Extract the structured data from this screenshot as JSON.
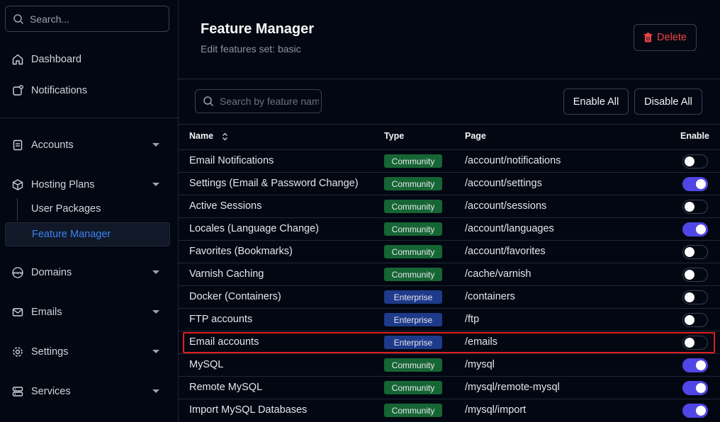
{
  "sidebar": {
    "search_placeholder": "Search...",
    "top_items": [
      {
        "label": "Dashboard",
        "icon": "home-icon"
      },
      {
        "label": "Notifications",
        "icon": "notification-icon"
      }
    ],
    "groups": [
      {
        "label": "Accounts",
        "icon": "accounts-icon"
      },
      {
        "label": "Hosting Plans",
        "icon": "package-icon",
        "children": [
          "User Packages",
          "Feature Manager"
        ]
      },
      {
        "label": "Domains",
        "icon": "www-icon"
      },
      {
        "label": "Emails",
        "icon": "mail-icon"
      },
      {
        "label": "Settings",
        "icon": "gear-icon"
      },
      {
        "label": "Services",
        "icon": "server-icon"
      }
    ]
  },
  "header": {
    "title": "Feature Manager",
    "subtitle": "Edit features set: basic",
    "delete_label": "Delete"
  },
  "toolbar": {
    "search_placeholder": "Search by feature name",
    "enable_all_label": "Enable All",
    "disable_all_label": "Disable All"
  },
  "table": {
    "columns": {
      "name": "Name",
      "type": "Type",
      "page": "Page",
      "enable": "Enable"
    },
    "rows": [
      {
        "name": "Email Notifications",
        "type": "Community",
        "page": "/account/notifications",
        "enabled": false
      },
      {
        "name": "Settings (Email & Password Change)",
        "type": "Community",
        "page": "/account/settings",
        "enabled": true
      },
      {
        "name": "Active Sessions",
        "type": "Community",
        "page": "/account/sessions",
        "enabled": false
      },
      {
        "name": "Locales (Language Change)",
        "type": "Community",
        "page": "/account/languages",
        "enabled": true
      },
      {
        "name": "Favorites (Bookmarks)",
        "type": "Community",
        "page": "/account/favorites",
        "enabled": false
      },
      {
        "name": "Varnish Caching",
        "type": "Community",
        "page": "/cache/varnish",
        "enabled": false
      },
      {
        "name": "Docker (Containers)",
        "type": "Enterprise",
        "page": "/containers",
        "enabled": false
      },
      {
        "name": "FTP accounts",
        "type": "Enterprise",
        "page": "/ftp",
        "enabled": false
      },
      {
        "name": "Email accounts",
        "type": "Enterprise",
        "page": "/emails",
        "enabled": false,
        "highlighted": true
      },
      {
        "name": "MySQL",
        "type": "Community",
        "page": "/mysql",
        "enabled": true
      },
      {
        "name": "Remote MySQL",
        "type": "Community",
        "page": "/mysql/remote-mysql",
        "enabled": true
      },
      {
        "name": "Import MySQL Databases",
        "type": "Community",
        "page": "/mysql/import",
        "enabled": true
      }
    ]
  },
  "colors": {
    "accent": "#4f46e5",
    "active_link": "#3b82f6",
    "danger": "#ef4444",
    "community_badge": "#166534",
    "enterprise_badge": "#1e3a8a",
    "highlight": "#e11d1d"
  }
}
